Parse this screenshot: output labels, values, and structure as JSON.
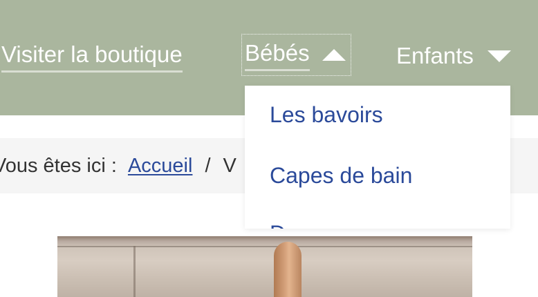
{
  "nav": {
    "shop_label": "Visiter la boutique",
    "babies_label": "Bébés",
    "kids_label": "Enfants"
  },
  "dropdown": {
    "items": [
      "Les bavoirs",
      "Capes de bain",
      "Draps"
    ]
  },
  "breadcrumb": {
    "prefix": "Vous êtes ici :",
    "home_label": "Accueil",
    "separator": "/",
    "current_partial": "V"
  },
  "colors": {
    "nav_bg": "#aab69e",
    "link": "#2b4a9a",
    "breadcrumb_bg": "#f5f5f5"
  },
  "icons": {
    "babies_caret": "caret-up-icon",
    "kids_caret": "caret-down-icon"
  }
}
